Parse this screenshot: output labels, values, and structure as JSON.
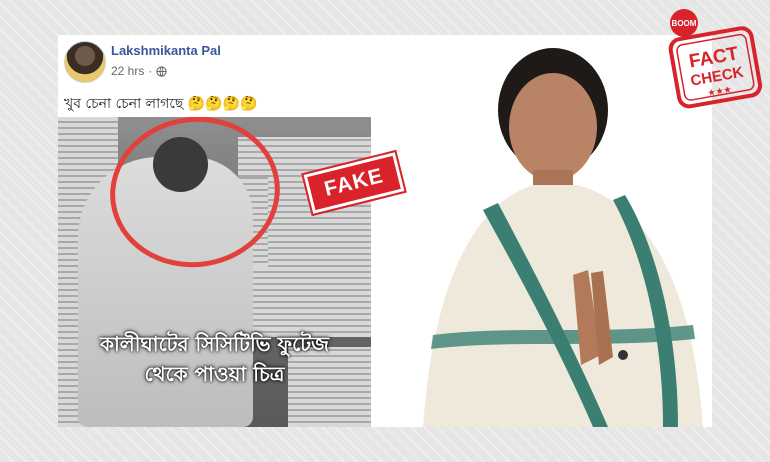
{
  "post": {
    "author": "Lakshmikanta Pal",
    "time": "22 hrs",
    "separator": "·",
    "text": "খুব চেনা চেনা লাগছে 🤔🤔🤔🤔"
  },
  "image": {
    "caption_line1": "কালীঘাটের সিসিটিভি ফুটেজ",
    "caption_line2": "থেকে পাওয়া চিত্র",
    "stamp": "FAKE"
  },
  "badge": {
    "top": "BOOM",
    "line1": "FACT",
    "line2": "CHECK",
    "stars": "★★★"
  },
  "colors": {
    "link_blue": "#385898",
    "stamp_red": "#d8232a",
    "saree_green": "#3b7f73"
  }
}
